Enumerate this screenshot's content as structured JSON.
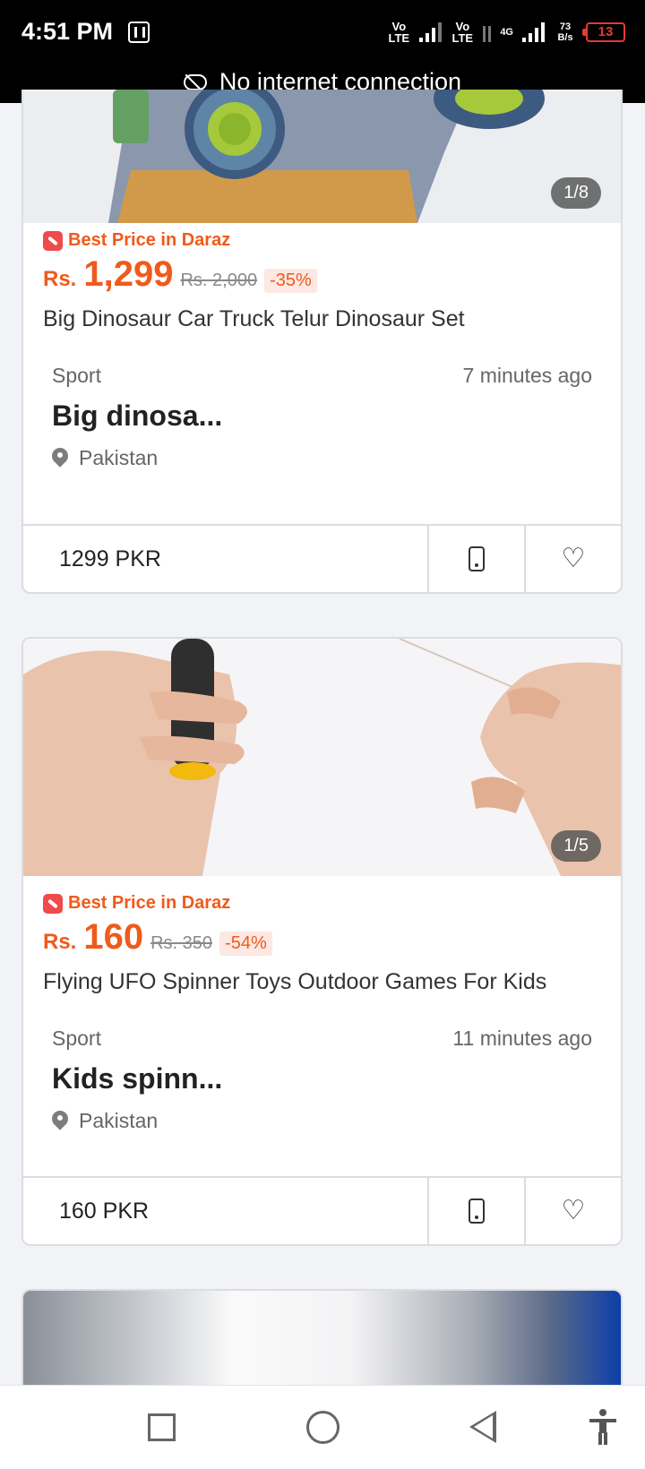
{
  "status_bar": {
    "time": "4:51 PM",
    "volte_1": "Vo LTE",
    "volte_2": "Vo LTE",
    "network": "4G",
    "speed": "73 B/s",
    "battery": "13"
  },
  "banner": {
    "text": "No internet connection",
    "icon": "cloud-off-icon"
  },
  "listings": [
    {
      "image_counter": "1/8",
      "daraz_tag": "Best Price in Daraz",
      "currency": "Rs.",
      "price": "1,299",
      "old_price": "Rs. 2,000",
      "discount": "-35%",
      "product_title": "Big Dinosaur Car Truck Telur Dinosaur Set",
      "category": "Sport",
      "time_ago": "7 minutes ago",
      "title": "Big dinosa...",
      "location": "Pakistan",
      "footer_price": "1299 PKR"
    },
    {
      "image_counter": "1/5",
      "daraz_tag": "Best Price in Daraz",
      "currency": "Rs.",
      "price": "160",
      "old_price": "Rs. 350",
      "discount": "-54%",
      "product_title": "Flying UFO Spinner Toys Outdoor Games For Kids",
      "category": "Sport",
      "time_ago": "11 minutes ago",
      "title": "Kids spinn...",
      "location": "Pakistan",
      "footer_price": "160 PKR"
    }
  ],
  "colors": {
    "accent": "#f05a1a",
    "discount_bg": "#fde8e4",
    "background": "#f2f3f7"
  }
}
